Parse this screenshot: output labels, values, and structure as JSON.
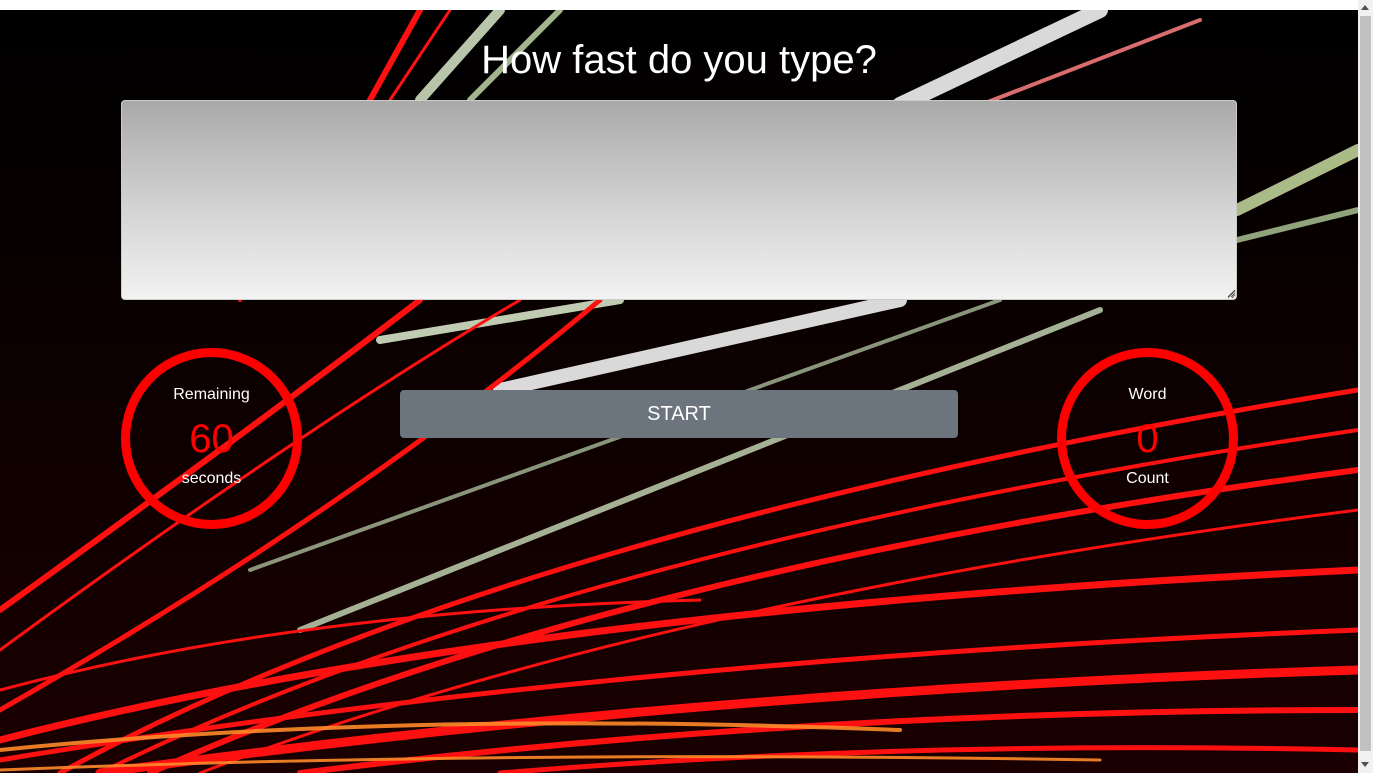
{
  "page": {
    "title": "How fast do you type?"
  },
  "typing_area": {
    "value": "",
    "placeholder": ""
  },
  "timer": {
    "label_top": "Remaining",
    "value": "60",
    "label_bottom": "seconds"
  },
  "word_count": {
    "label_top": "Word",
    "value": "0",
    "label_bottom": "Count"
  },
  "controls": {
    "start_label": "START"
  },
  "colors": {
    "accent": "#ff0000",
    "button": "#6c757d",
    "background": "#000000"
  }
}
